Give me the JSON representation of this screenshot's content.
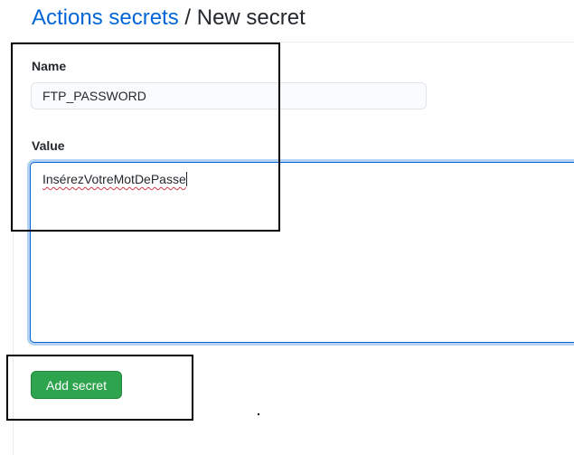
{
  "breadcrumb": {
    "parent_label": "Actions secrets",
    "separator": " / ",
    "current_label": "New secret"
  },
  "form": {
    "name_label": "Name",
    "name_value": "FTP_PASSWORD",
    "value_label": "Value",
    "value_text": "InsérezVotreMotDePasse",
    "submit_label": "Add secret"
  },
  "colors": {
    "link": "#0366d6",
    "primary_button": "#2ea44f",
    "focus_border": "#0366d6",
    "spellcheck_underline": "#d73a49"
  }
}
